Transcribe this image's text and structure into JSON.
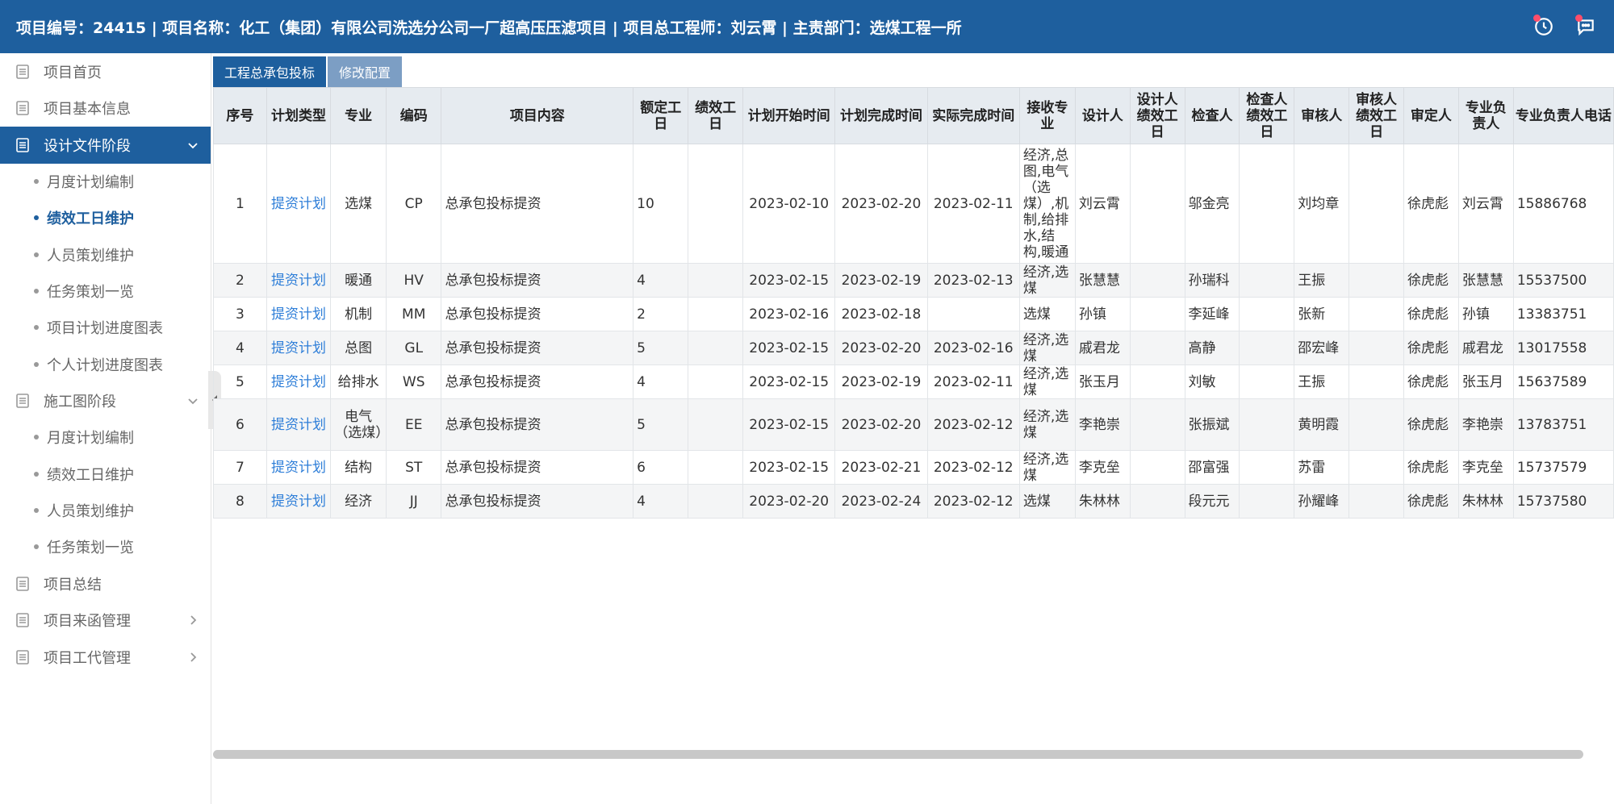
{
  "header": {
    "title": "项目编号：24415 | 项目名称：化工（集团）有限公司洗选分公司一厂超高压压滤项目 | 项目总工程师：刘云霄 | 主责部门：选煤工程一所"
  },
  "sidebar": {
    "menu": [
      {
        "label": "项目首页"
      },
      {
        "label": "项目基本信息"
      },
      {
        "label": "设计文件阶段",
        "active": true,
        "expanded": true,
        "children": [
          "月度计划编制",
          "绩效工日维护",
          "人员策划维护",
          "任务策划一览",
          "项目计划进度图表",
          "个人计划进度图表"
        ]
      },
      {
        "label": "施工图阶段",
        "expanded": true,
        "children": [
          "月度计划编制",
          "绩效工日维护",
          "人员策划维护",
          "任务策划一览"
        ]
      },
      {
        "label": "项目总结"
      },
      {
        "label": "项目来函管理"
      },
      {
        "label": "项目工代管理"
      }
    ],
    "current_sub": "绩效工日维护"
  },
  "tabs": [
    "工程总承包投标",
    "修改配置"
  ],
  "table": {
    "headers": [
      "序号",
      "计划类型",
      "专业",
      "编码",
      "项目内容",
      "额定工日",
      "绩效工日",
      "计划开始时间",
      "计划完成时间",
      "实际完成时间",
      "接收专业",
      "设计人",
      "设计人绩效工日",
      "检查人",
      "检查人绩效工日",
      "审核人",
      "审核人绩效工日",
      "审定人",
      "专业负责人",
      "专业负责人电话"
    ],
    "rows": [
      [
        "1",
        "提资计划",
        "选煤",
        "CP",
        "总承包投标提资",
        "10",
        "",
        "2023-02-10",
        "2023-02-20",
        "2023-02-11",
        "经济,总图,电气（选煤）,机制,给排水,结构,暖通",
        "刘云霄",
        "",
        "邬金亮",
        "",
        "刘均章",
        "",
        "徐虎彪",
        "刘云霄",
        "15886768"
      ],
      [
        "2",
        "提资计划",
        "暖通",
        "HV",
        "总承包投标提资",
        "4",
        "",
        "2023-02-15",
        "2023-02-19",
        "2023-02-13",
        "经济,选煤",
        "张慧慧",
        "",
        "孙瑞科",
        "",
        "王振",
        "",
        "徐虎彪",
        "张慧慧",
        "15537500"
      ],
      [
        "3",
        "提资计划",
        "机制",
        "MM",
        "总承包投标提资",
        "2",
        "",
        "2023-02-16",
        "2023-02-18",
        "",
        "选煤",
        "孙镇",
        "",
        "李延峰",
        "",
        "张新",
        "",
        "徐虎彪",
        "孙镇",
        "13383751"
      ],
      [
        "4",
        "提资计划",
        "总图",
        "GL",
        "总承包投标提资",
        "5",
        "",
        "2023-02-15",
        "2023-02-20",
        "2023-02-16",
        "经济,选煤",
        "戚君龙",
        "",
        "高静",
        "",
        "邵宏峰",
        "",
        "徐虎彪",
        "戚君龙",
        "13017558"
      ],
      [
        "5",
        "提资计划",
        "给排水",
        "WS",
        "总承包投标提资",
        "4",
        "",
        "2023-02-15",
        "2023-02-19",
        "2023-02-11",
        "经济,选煤",
        "张玉月",
        "",
        "刘敏",
        "",
        "王振",
        "",
        "徐虎彪",
        "张玉月",
        "15637589"
      ],
      [
        "6",
        "提资计划",
        "电气（选煤）",
        "EE",
        "总承包投标提资",
        "5",
        "",
        "2023-02-15",
        "2023-02-20",
        "2023-02-12",
        "经济,选煤",
        "李艳崇",
        "",
        "张振斌",
        "",
        "黄明霞",
        "",
        "徐虎彪",
        "李艳崇",
        "13783751"
      ],
      [
        "7",
        "提资计划",
        "结构",
        "ST",
        "总承包投标提资",
        "6",
        "",
        "2023-02-15",
        "2023-02-21",
        "2023-02-12",
        "经济,选煤",
        "李克垒",
        "",
        "邵富强",
        "",
        "苏雷",
        "",
        "徐虎彪",
        "李克垒",
        "15737579"
      ],
      [
        "8",
        "提资计划",
        "经济",
        "JJ",
        "总承包投标提资",
        "4",
        "",
        "2023-02-20",
        "2023-02-24",
        "2023-02-12",
        "选煤",
        "朱林林",
        "",
        "段元元",
        "",
        "孙耀峰",
        "",
        "徐虎彪",
        "朱林林",
        "15737580"
      ]
    ]
  },
  "colors": {
    "header_bg": "#1e5f9e",
    "active_menu_bg": "#1e5f9e",
    "link": "#2e7ed8",
    "tab_secondary": "#7c9ec4",
    "badge": "#ff4d6a"
  }
}
